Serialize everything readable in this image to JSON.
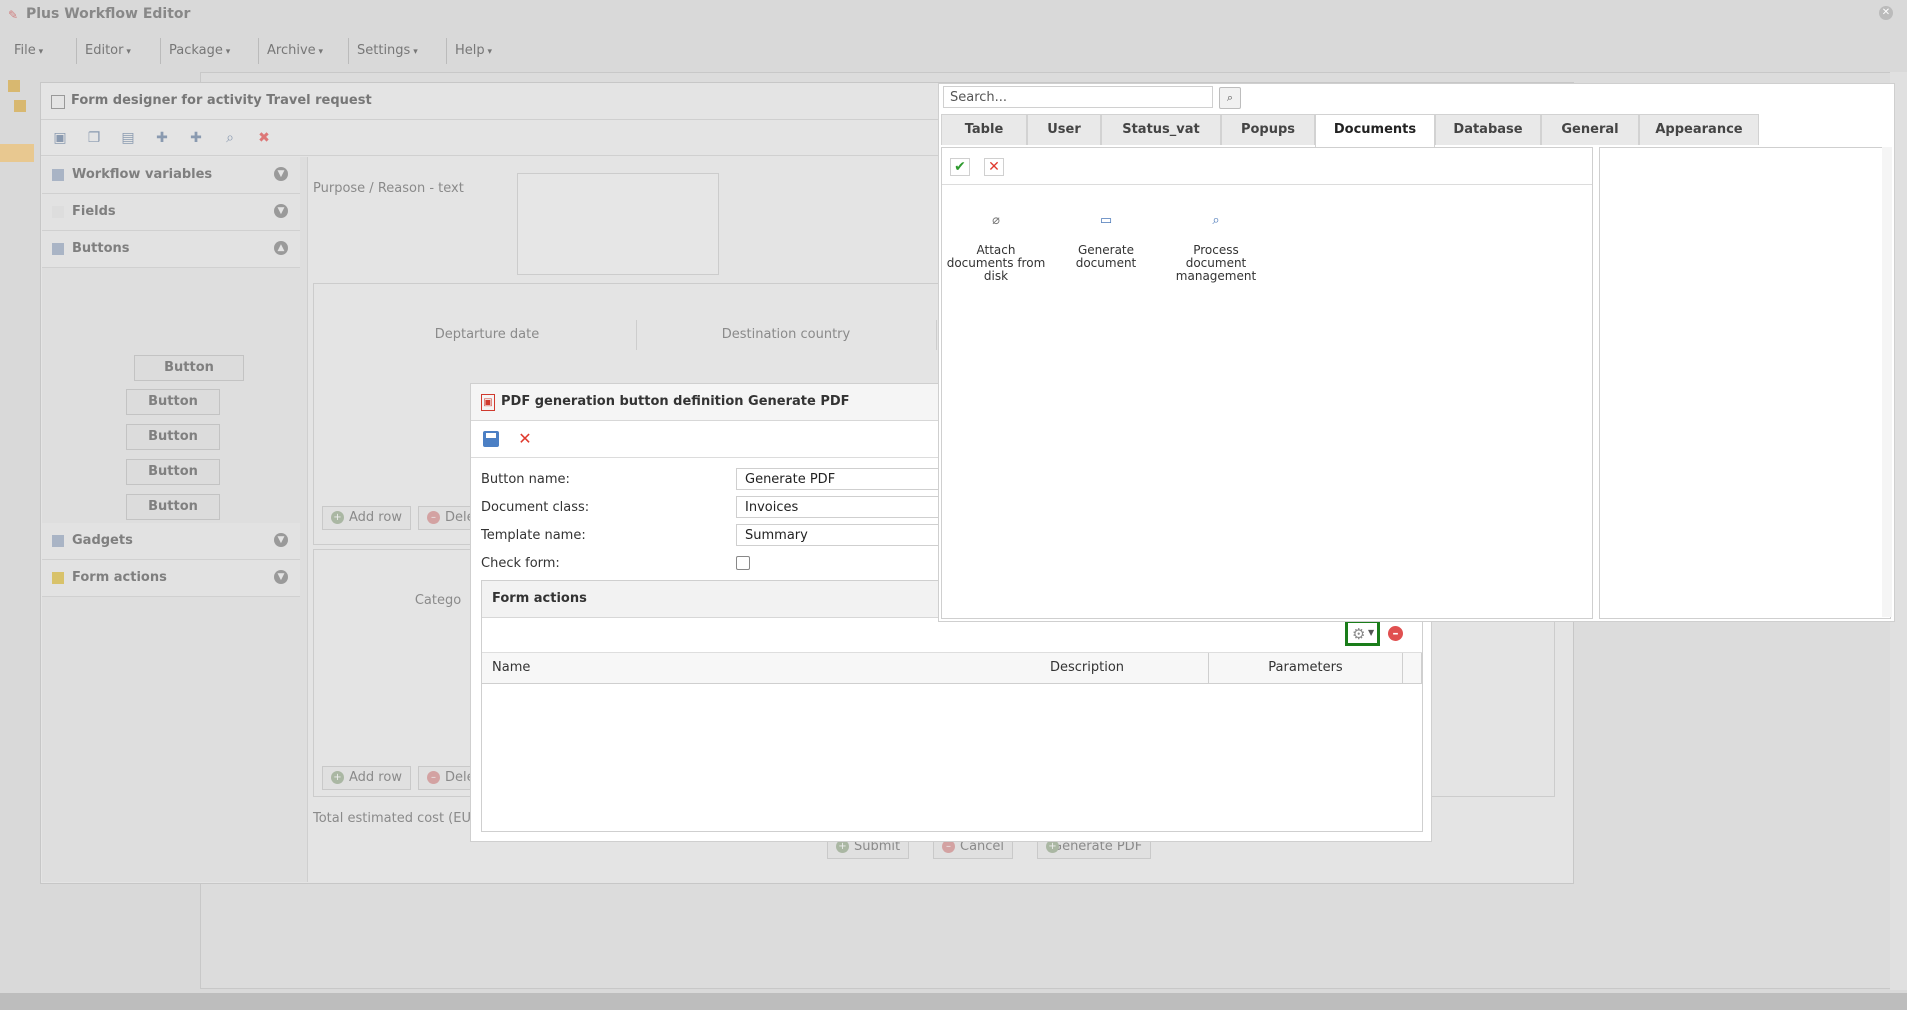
{
  "app": {
    "title": "Plus Workflow Editor"
  },
  "menu": [
    "File",
    "Editor",
    "Package",
    "Archive",
    "Settings",
    "Help"
  ],
  "designer": {
    "title": "Form designer for activity Travel request",
    "sections": [
      "Workflow variables",
      "Fields",
      "Buttons",
      "Gadgets",
      "Form actions"
    ],
    "button_samples": [
      "Button",
      "Button",
      "Button",
      "Button",
      "Button"
    ],
    "canvas": {
      "purpose_reason_text": "Purpose / Reason - text",
      "columns1": [
        "Deptarture date",
        "Destination country"
      ],
      "add_row": "Add row",
      "delete_row": "Dele",
      "category_col": "Catego",
      "total_cost": "Total estimated cost (EUR)",
      "bottom_buttons": [
        "Submit",
        "Cancel",
        "Generate PDF"
      ]
    }
  },
  "pdf_dialog": {
    "title": "PDF generation button definition Generate PDF",
    "labels": {
      "button_name": "Button name:",
      "document_class": "Document class:",
      "template_name": "Template name:",
      "check_form": "Check form:"
    },
    "values": {
      "button_name": "Generate PDF",
      "document_class": "Invoices",
      "template_name": "Summary"
    },
    "form_actions": {
      "title": "Form actions",
      "columns": [
        "Name",
        "Description",
        "Parameters"
      ]
    }
  },
  "palette": {
    "search_placeholder": "Search...",
    "tabs": [
      "Table",
      "User",
      "Status_vat",
      "Popups",
      "Documents",
      "Database",
      "General",
      "Appearance"
    ],
    "active_tab": "Documents",
    "items": [
      {
        "label": "Attach documents from disk",
        "icon": "paperclip-icon"
      },
      {
        "label": "Generate document",
        "icon": "window-icon"
      },
      {
        "label": "Process document management",
        "icon": "magnifier-icon"
      }
    ]
  },
  "colors": {
    "highlight": "#1a7d1a",
    "delete_red": "#e03a2e",
    "accept_green": "#2e9a2e"
  }
}
